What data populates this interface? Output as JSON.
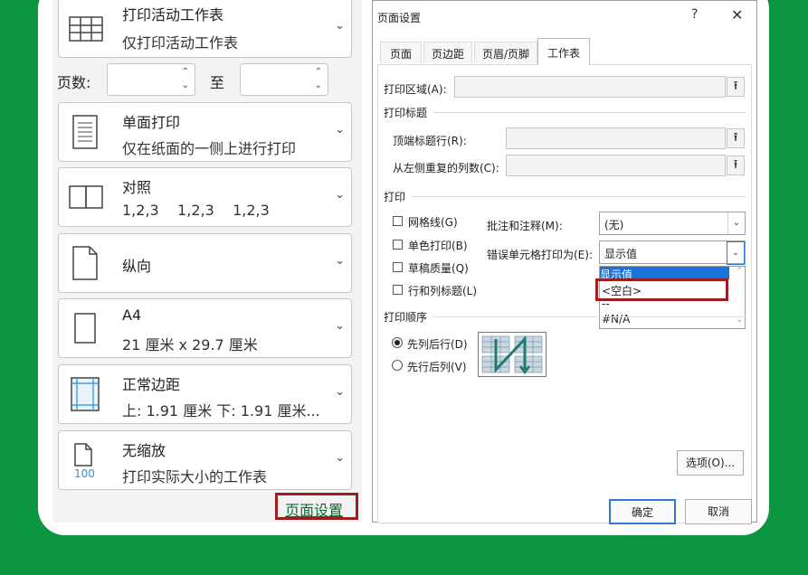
{
  "print_panel": {
    "what_to_print": {
      "title": "打印活动工作表",
      "subtitle": "仅打印活动工作表"
    },
    "pages_label": "页数:",
    "to_label": "至",
    "sides": {
      "title": "单面打印",
      "subtitle": "仅在纸面的一侧上进行打印"
    },
    "collation": {
      "title": "对照",
      "subtitle": "1,2,3    1,2,3    1,2,3"
    },
    "orientation": {
      "title": "纵向"
    },
    "paper": {
      "title": "A4",
      "subtitle": "21 厘米 x 29.7 厘米"
    },
    "margins": {
      "title": "正常边距",
      "subtitle": "上: 1.91 厘米 下: 1.91 厘米..."
    },
    "scaling": {
      "title": "无缩放",
      "subtitle": "打印实际大小的工作表",
      "icon_text": "100"
    },
    "page_setup_link": "页面设置"
  },
  "dialog": {
    "title": "页面设置",
    "help": "?",
    "close": "✕",
    "tabs": [
      "页面",
      "页边距",
      "页眉/页脚",
      "工作表"
    ],
    "active_tab": "工作表",
    "print_area_label": "打印区域(A):",
    "print_titles_section": "打印标题",
    "rows_repeat_label": "顶端标题行(R):",
    "cols_repeat_label": "从左侧重复的列数(C):",
    "print_section": "打印",
    "checkboxes": [
      "网格线(G)",
      "单色打印(B)",
      "草稿质量(Q)",
      "行和列标题(L)"
    ],
    "comments_label": "批注和注释(M):",
    "comments_value": "(无)",
    "errors_label": "错误单元格打印为(E):",
    "errors_value": "显示值",
    "errors_options": [
      "显示值",
      "<空白>",
      "--",
      "#N/A"
    ],
    "order_section": "打印顺序",
    "radios": [
      "先列后行(D)",
      "先行后列(V)"
    ],
    "options_button": "选项(O)...",
    "ok_button": "确定",
    "cancel_button": "取消"
  },
  "colors": {
    "background": "#0d9640",
    "highlight": "#9b1f20",
    "selection": "#1a73d9",
    "link": "#0b6a2a"
  }
}
